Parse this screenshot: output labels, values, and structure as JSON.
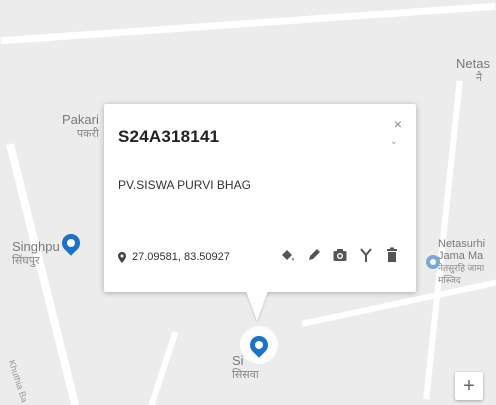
{
  "colors": {
    "accent": "#1a73c8",
    "map_bg": "#ececec",
    "poi": "#7aa7d6"
  },
  "places": {
    "pakari": {
      "name": "Pakari",
      "local": "पकरी"
    },
    "singhpur": {
      "name": "Singhpu",
      "local": "सिंघपुर"
    },
    "netasurhi": {
      "name": "Netas",
      "local": "नै"
    },
    "jama": {
      "name": "Netasurhi Jama Ma",
      "local": "नेतसुरहि जामा मस्जिद"
    },
    "siswa": {
      "name": "Si",
      "local": "सिसवा"
    },
    "road": {
      "name": "Khuthia Ba"
    }
  },
  "popup": {
    "title": "S24A318141",
    "subtitle": "PV.SISWA PURVI BHAG",
    "coordinates": "27.09581, 83.50927",
    "close_icon": "×",
    "actions": [
      "paint-bucket-icon",
      "pencil-icon",
      "camera-icon",
      "antenna-icon",
      "trash-icon"
    ]
  },
  "zoom": {
    "plus_label": "+"
  }
}
